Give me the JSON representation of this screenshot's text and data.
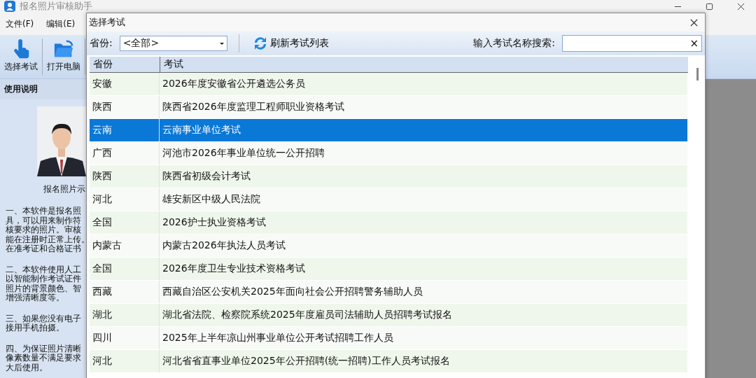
{
  "window": {
    "title": "报名照片审核助手"
  },
  "menu": [
    "文件(F)",
    "编辑(E)"
  ],
  "toolbar": [
    {
      "label": "选择考试",
      "kind": "hand"
    },
    {
      "label": "打开电脑",
      "kind": "folder"
    }
  ],
  "help": {
    "title": "使用说明",
    "photo_caption": "报名照片示",
    "paragraphs": [
      [
        "一、本软件是报名照",
        "具，可以用来制作符",
        "核要求的照片。审核",
        "能在注册时正常上传。",
        "在准考证和合格证书"
      ],
      [
        "二、本软件使用人工",
        "以智能制作考试证件",
        "照片的背景颜色、智",
        "增强清晰度等。"
      ],
      [
        "三、如果您没有电子",
        "接用手机拍摄。"
      ],
      [
        "四、为保证照片清晰",
        "像素数量不满足要求",
        "大后使用。"
      ]
    ]
  },
  "dialog": {
    "title": "选择考试",
    "province_label": "省份:",
    "province_value": "<全部>",
    "refresh": "刷新考试列表",
    "search_label": "输入考试名称搜索:",
    "search_clear": "×",
    "columns": [
      "省份",
      "考试"
    ],
    "rows": [
      {
        "province": "安徽",
        "exam": "2026年度安徽省公开遴选公务员",
        "selected": false
      },
      {
        "province": "陕西",
        "exam": "陕西省2026年度监理工程师职业资格考试",
        "selected": false
      },
      {
        "province": "云南",
        "exam": "云南事业单位考试",
        "selected": true
      },
      {
        "province": "广西",
        "exam": "河池市2026年事业单位统一公开招聘",
        "selected": false
      },
      {
        "province": "陕西",
        "exam": "陕西省初级会计考试",
        "selected": false
      },
      {
        "province": "河北",
        "exam": "雄安新区中级人民法院",
        "selected": false
      },
      {
        "province": "全国",
        "exam": "2026护士执业资格考试",
        "selected": false
      },
      {
        "province": "内蒙古",
        "exam": "内蒙古2026年执法人员考试",
        "selected": false
      },
      {
        "province": "全国",
        "exam": "2026年度卫生专业技术资格考试",
        "selected": false
      },
      {
        "province": "西藏",
        "exam": "西藏自治区公安机关2025年面向社会公开招聘警务辅助人员",
        "selected": false
      },
      {
        "province": "湖北",
        "exam": "湖北省法院、检察院系统2025年度雇员司法辅助人员招聘考试报名",
        "selected": false
      },
      {
        "province": "四川",
        "exam": "2025年上半年凉山州事业单位公开考试招聘工作人员",
        "selected": false
      },
      {
        "province": "河北",
        "exam": "河北省省直事业单位2025年公开招聘(统一招聘)工作人员考试报名",
        "selected": false
      }
    ]
  }
}
